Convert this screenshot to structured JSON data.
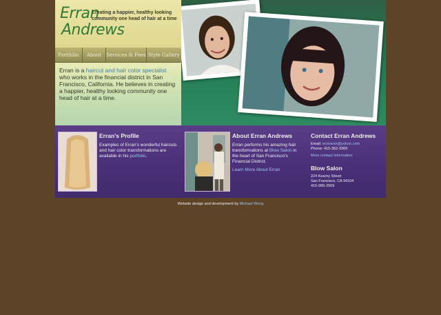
{
  "header": {
    "logo_line1": "Erran",
    "logo_line2": "Andrews",
    "tagline": "Creating a happier, healthy looking community one head of hair at a time"
  },
  "nav": {
    "items": [
      {
        "label": "Portfolio"
      },
      {
        "label": "About"
      },
      {
        "label": "Services & Fees"
      },
      {
        "label": "Style Gallery"
      }
    ]
  },
  "intro": {
    "prefix": "Erran is a ",
    "highlight": "haircut and hair color specialist",
    "rest": " who works in the financial district in San Francisco, California. He believes in creating a happier, healthy looking community one head of hair at a time."
  },
  "profile": {
    "title": "Erran's Profile",
    "text": "Examples of Erran's wonderful haircuts and hair color transformations are available in his",
    "link": "portfolio",
    "suffix": "."
  },
  "about": {
    "title": "About Erran Andrews",
    "text_before": "Erran performs his amazing hair transformations at ",
    "salon_link": "Blow Salon",
    "text_after": " in the heart of San Francisco's Financial District.",
    "more_link": "Learn More About Erran"
  },
  "contact": {
    "title": "Contact Erran Andrews",
    "email_label": "Email: ",
    "email": "erranesh@yahoo.com",
    "phone": "Phone: 415-362-3369",
    "more_link": "More contact information"
  },
  "salon": {
    "title": "Blow Salon",
    "address1": "224 Kearny Street",
    "address2": "San Francisco, CA 94104",
    "phone": "415-989-2569"
  },
  "footer": {
    "text": "Website design and development by ",
    "author": "Michael Wong"
  },
  "colors": {
    "background": "#5d4327",
    "panel": "#4a3079",
    "link": "#9cc7ee",
    "logo_green": "#2f7a35"
  }
}
